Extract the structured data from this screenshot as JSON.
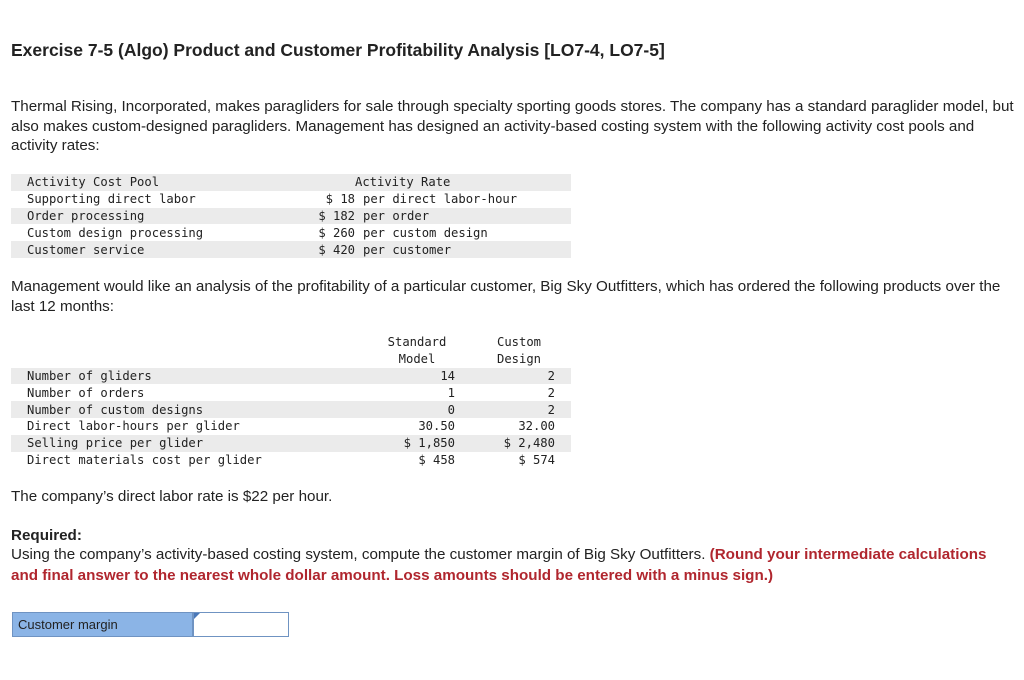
{
  "title": "Exercise 7-5 (Algo) Product and Customer Profitability Analysis [LO7-4, LO7-5]",
  "intro": "Thermal Rising, Incorporated, makes paragliders for sale through specialty sporting goods stores. The company has a standard paraglider model, but also makes custom-designed paragliders. Management has designed an activity-based costing system with the following activity cost pools and activity rates:",
  "activity_table": {
    "headers": [
      "Activity Cost Pool",
      "Activity Rate"
    ],
    "rows": [
      {
        "pool": "Supporting direct labor",
        "rate": "$ 18",
        "unit": "per direct labor-hour"
      },
      {
        "pool": "Order processing",
        "rate": "$ 182",
        "unit": "per order"
      },
      {
        "pool": "Custom design processing",
        "rate": "$ 260",
        "unit": "per custom design"
      },
      {
        "pool": "Customer service",
        "rate": "$ 420",
        "unit": "per customer"
      }
    ]
  },
  "middle_text": "Management would like an analysis of the profitability of a particular customer, Big Sky Outfitters, which has ordered the following products over the last 12 months:",
  "product_table": {
    "col1_line1": "Standard",
    "col1_line2": "Model",
    "col2_line1": "Custom",
    "col2_line2": "Design",
    "rows": [
      {
        "label": "Number of gliders",
        "standard": "14",
        "custom": "2"
      },
      {
        "label": "Number of orders",
        "standard": "1",
        "custom": "2"
      },
      {
        "label": "Number of custom designs",
        "standard": "0",
        "custom": "2"
      },
      {
        "label": "Direct labor-hours per glider",
        "standard": "30.50",
        "custom": "32.00"
      },
      {
        "label": "Selling price per glider",
        "standard": "$ 1,850",
        "custom": "$ 2,480"
      },
      {
        "label": "Direct materials cost per glider",
        "standard": "$ 458",
        "custom": "$ 574"
      }
    ]
  },
  "labor_rate_text": "The company’s direct labor rate is $22 per hour.",
  "required_heading": "Required:",
  "required_text": "Using the company’s activity-based costing system, compute the customer margin of Big Sky Outfitters.",
  "required_note": "(Round your intermediate calculations and final answer to the nearest whole dollar amount. Loss amounts should be entered with a minus sign.)",
  "answer": {
    "label": "Customer margin",
    "value": ""
  }
}
